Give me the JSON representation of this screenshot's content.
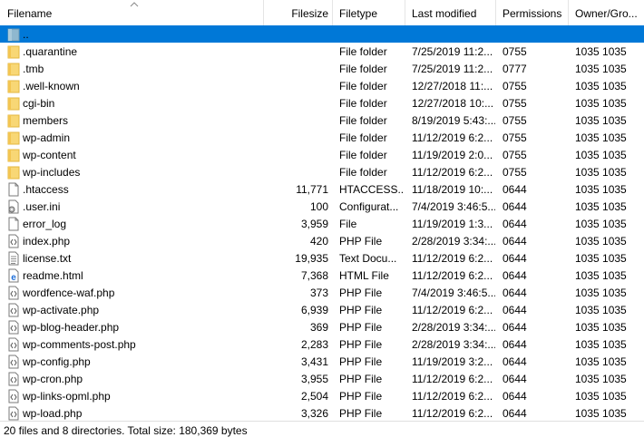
{
  "columns": {
    "filename": "Filename",
    "filesize": "Filesize",
    "filetype": "Filetype",
    "last_modified": "Last modified",
    "permissions": "Permissions",
    "owner_group": "Owner/Gro..."
  },
  "rows": [
    {
      "icon": "parent-folder-icon",
      "name": "..",
      "size": "",
      "type": "",
      "modified": "",
      "perms": "",
      "owner": "",
      "selected": true
    },
    {
      "icon": "folder-icon",
      "name": ".quarantine",
      "size": "",
      "type": "File folder",
      "modified": "7/25/2019 11:2...",
      "perms": "0755",
      "owner": "1035 1035"
    },
    {
      "icon": "folder-icon",
      "name": ".tmb",
      "size": "",
      "type": "File folder",
      "modified": "7/25/2019 11:2...",
      "perms": "0777",
      "owner": "1035 1035"
    },
    {
      "icon": "folder-icon",
      "name": ".well-known",
      "size": "",
      "type": "File folder",
      "modified": "12/27/2018 11:...",
      "perms": "0755",
      "owner": "1035 1035"
    },
    {
      "icon": "folder-icon",
      "name": "cgi-bin",
      "size": "",
      "type": "File folder",
      "modified": "12/27/2018 10:...",
      "perms": "0755",
      "owner": "1035 1035"
    },
    {
      "icon": "folder-icon",
      "name": "members",
      "size": "",
      "type": "File folder",
      "modified": "8/19/2019 5:43:...",
      "perms": "0755",
      "owner": "1035 1035"
    },
    {
      "icon": "folder-icon",
      "name": "wp-admin",
      "size": "",
      "type": "File folder",
      "modified": "11/12/2019 6:2...",
      "perms": "0755",
      "owner": "1035 1035"
    },
    {
      "icon": "folder-icon",
      "name": "wp-content",
      "size": "",
      "type": "File folder",
      "modified": "11/19/2019 2:0...",
      "perms": "0755",
      "owner": "1035 1035"
    },
    {
      "icon": "folder-icon",
      "name": "wp-includes",
      "size": "",
      "type": "File folder",
      "modified": "11/12/2019 6:2...",
      "perms": "0755",
      "owner": "1035 1035"
    },
    {
      "icon": "file-icon",
      "name": ".htaccess",
      "size": "11,771",
      "type": "HTACCESS...",
      "modified": "11/18/2019 10:...",
      "perms": "0644",
      "owner": "1035 1035"
    },
    {
      "icon": "config-file-icon",
      "name": ".user.ini",
      "size": "100",
      "type": "Configurat...",
      "modified": "7/4/2019 3:46:5...",
      "perms": "0644",
      "owner": "1035 1035"
    },
    {
      "icon": "file-icon",
      "name": "error_log",
      "size": "3,959",
      "type": "File",
      "modified": "11/19/2019 1:3...",
      "perms": "0644",
      "owner": "1035 1035"
    },
    {
      "icon": "php-file-icon",
      "name": "index.php",
      "size": "420",
      "type": "PHP File",
      "modified": "2/28/2019 3:34:...",
      "perms": "0644",
      "owner": "1035 1035"
    },
    {
      "icon": "text-file-icon",
      "name": "license.txt",
      "size": "19,935",
      "type": "Text Docu...",
      "modified": "11/12/2019 6:2...",
      "perms": "0644",
      "owner": "1035 1035"
    },
    {
      "icon": "html-file-icon",
      "name": "readme.html",
      "size": "7,368",
      "type": "HTML File",
      "modified": "11/12/2019 6:2...",
      "perms": "0644",
      "owner": "1035 1035"
    },
    {
      "icon": "php-file-icon",
      "name": "wordfence-waf.php",
      "size": "373",
      "type": "PHP File",
      "modified": "7/4/2019 3:46:5...",
      "perms": "0644",
      "owner": "1035 1035"
    },
    {
      "icon": "php-file-icon",
      "name": "wp-activate.php",
      "size": "6,939",
      "type": "PHP File",
      "modified": "11/12/2019 6:2...",
      "perms": "0644",
      "owner": "1035 1035"
    },
    {
      "icon": "php-file-icon",
      "name": "wp-blog-header.php",
      "size": "369",
      "type": "PHP File",
      "modified": "2/28/2019 3:34:...",
      "perms": "0644",
      "owner": "1035 1035"
    },
    {
      "icon": "php-file-icon",
      "name": "wp-comments-post.php",
      "size": "2,283",
      "type": "PHP File",
      "modified": "2/28/2019 3:34:...",
      "perms": "0644",
      "owner": "1035 1035"
    },
    {
      "icon": "php-file-icon",
      "name": "wp-config.php",
      "size": "3,431",
      "type": "PHP File",
      "modified": "11/19/2019 3:2...",
      "perms": "0644",
      "owner": "1035 1035"
    },
    {
      "icon": "php-file-icon",
      "name": "wp-cron.php",
      "size": "3,955",
      "type": "PHP File",
      "modified": "11/12/2019 6:2...",
      "perms": "0644",
      "owner": "1035 1035"
    },
    {
      "icon": "php-file-icon",
      "name": "wp-links-opml.php",
      "size": "2,504",
      "type": "PHP File",
      "modified": "11/12/2019 6:2...",
      "perms": "0644",
      "owner": "1035 1035"
    },
    {
      "icon": "php-file-icon",
      "name": "wp-load.php",
      "size": "3,326",
      "type": "PHP File",
      "modified": "11/12/2019 6:2...",
      "perms": "0644",
      "owner": "1035 1035"
    }
  ],
  "status": {
    "text": "20 files and 8 directories. Total size: 180,369 bytes"
  },
  "colors": {
    "selection": "#0078d7",
    "folder": "#f8d775",
    "folder_edge": "#e3b73f"
  }
}
